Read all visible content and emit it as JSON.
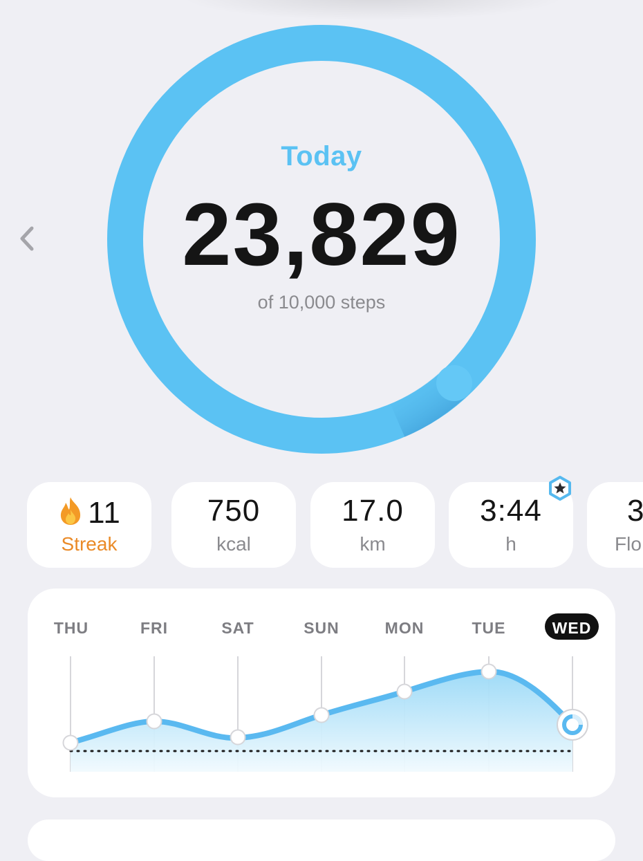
{
  "summary": {
    "period_label": "Today",
    "steps_value": "23,829",
    "steps_goal_text": "of 10,000 steps",
    "goal_progress": 2.3829
  },
  "navigation": {
    "previous_icon": "chevron-left-icon"
  },
  "stats": [
    {
      "value": "11",
      "label": "Streak",
      "icon": "flame-icon"
    },
    {
      "value": "750",
      "label": "kcal"
    },
    {
      "value": "17.0",
      "label": "km"
    },
    {
      "value": "3:44",
      "label": "h",
      "badge_icon": "star-badge-icon"
    },
    {
      "value": "3",
      "label": "Flo"
    }
  ],
  "weekly_chart": {
    "days": [
      "THU",
      "FRI",
      "SAT",
      "SUN",
      "MON",
      "TUE",
      "WED"
    ],
    "active_day": "WED",
    "colors": {
      "line": "#5ab9f0",
      "fill_top": "#a8def8",
      "fill_bottom": "#eaf7fd",
      "goal_line": "#1a1a1a"
    }
  },
  "colors": {
    "ring": "#5bc2f3",
    "accent_text": "#5bc2f3",
    "streak": "#ea8a27",
    "background": "#efeff4"
  }
}
